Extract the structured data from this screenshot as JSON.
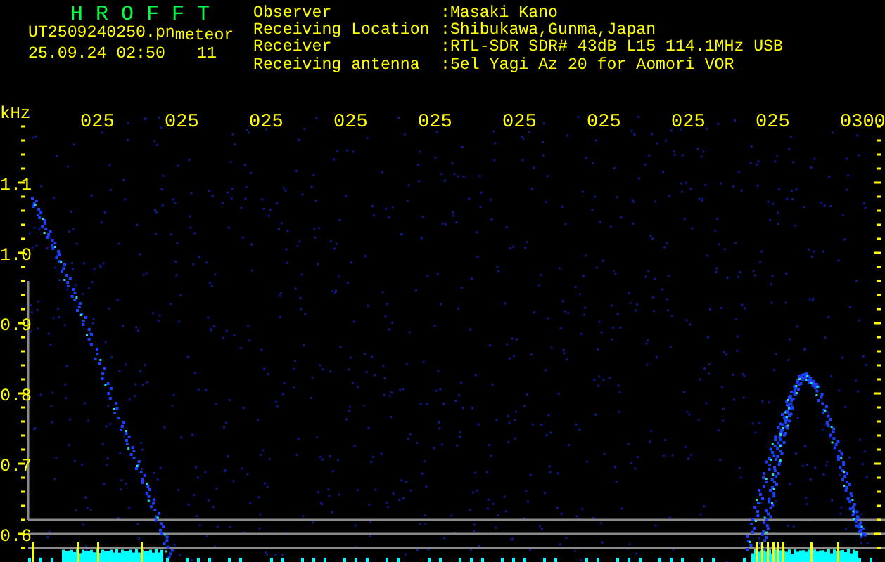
{
  "app_title": "H R O F F T",
  "file": {
    "name": "UT2509240250.pn",
    "category": "meteor",
    "datetime": "25.09.24 02:50",
    "count": "11"
  },
  "info": [
    {
      "label": "Observer",
      "value": ":Masaki Kano"
    },
    {
      "label": "Receiving Location",
      "value": ":Shibukawa,Gunma,Japan"
    },
    {
      "label": "Receiver",
      "value": ":RTL-SDR SDR# 43dB L15 114.1MHz USB"
    },
    {
      "label": "Receiving antenna",
      "value": ":5el Yagi Az 20 for Aomori VOR"
    }
  ],
  "plot": {
    "unit": "kHz",
    "time_labels": [
      "025",
      "025",
      "025",
      "025",
      "025",
      "025",
      "025",
      "025",
      "025",
      "0300"
    ],
    "freq_labels": [
      "1.1",
      "1.0",
      "0.9",
      "0.8",
      "0.7",
      "0.6"
    ]
  }
}
